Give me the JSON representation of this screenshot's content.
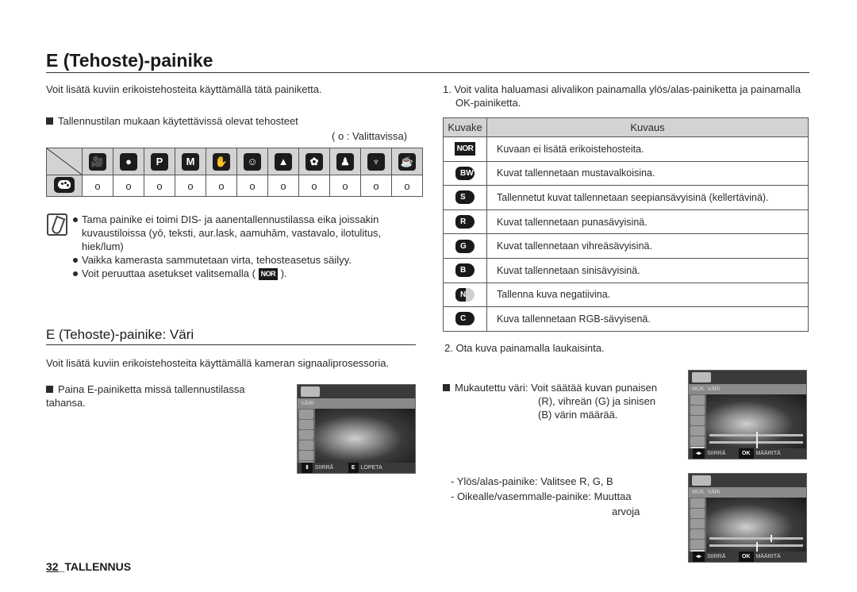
{
  "title": "E (Tehoste)-painike",
  "intro": "Voit lisätä kuviin erikoistehosteita käyttämällä tätä painiketta.",
  "modes_heading": "Tallennustilan mukaan käytettävissä olevat tehosteet",
  "modes_legend": "( o : Valittavissa)",
  "modes_table": {
    "row_icon": "palette-icon",
    "columns": [
      {
        "icon": "movie-icon",
        "glyph": "🎥"
      },
      {
        "icon": "auto-icon",
        "glyph": "●"
      },
      {
        "icon": "program-icon",
        "glyph": "P"
      },
      {
        "icon": "manual-icon",
        "glyph": "M"
      },
      {
        "icon": "dis-icon",
        "glyph": "✋"
      },
      {
        "icon": "photo-help-icon",
        "glyph": "☺"
      },
      {
        "icon": "landscape-icon",
        "glyph": "▲"
      },
      {
        "icon": "closeup-icon",
        "glyph": "✿"
      },
      {
        "icon": "portrait-icon",
        "glyph": "♟"
      },
      {
        "icon": "food-icon",
        "glyph": "♆"
      },
      {
        "icon": "cafe-icon",
        "glyph": "☕"
      }
    ],
    "values": [
      "o",
      "o",
      "o",
      "o",
      "o",
      "o",
      "o",
      "o",
      "o",
      "o",
      "o"
    ]
  },
  "note": {
    "items": [
      "Tama painike ei toimi DIS- ja aanentallennustilassa eika joissakin kuvaustiloissa (yō, teksti, aur.lask, aamuhām, vastavalo, ilotulitus, hiek/lum)",
      "Vaikka kamerasta sammutetaan virta, tehosteasetus säilyy."
    ],
    "last_item_prefix": "Voit peruuttaa asetukset valitsemalla (",
    "last_item_icon": "NOR",
    "last_item_suffix": ")."
  },
  "section2": {
    "title": "E (Tehoste)-painike: Väri",
    "intro": "Voit lisätä kuviin erikoistehosteita käyttämällä kameran signaaliprosessoria.",
    "instruction": "Paina E-painiketta missä tallennustilassa tahansa.",
    "lcd1": {
      "menu": "VÄRI",
      "left_key": "SIIRRÄ",
      "right_key_icon": "E",
      "right_key": "LOPETA"
    }
  },
  "step1": "1. Voit valita haluamasi alivalikon painamalla ylös/alas-painiketta ja painamalla OK-painiketta.",
  "effects_table": {
    "headers": [
      "Kuvake",
      "Kuvaus"
    ],
    "rows": [
      {
        "icon": "NOR",
        "type": "nor",
        "desc": "Kuvaan ei lisätä erikoistehosteita."
      },
      {
        "icon": "BW",
        "type": "blob",
        "desc": "Kuvat tallennetaan mustavalkoisina."
      },
      {
        "icon": "S",
        "type": "blob",
        "desc": "Tallennetut kuvat tallennetaan seepiansävyisinä (kellertävinä)."
      },
      {
        "icon": "R",
        "type": "blob",
        "desc": "Kuvat tallennetaan punasävyisinä."
      },
      {
        "icon": "G",
        "type": "blob",
        "desc": "Kuvat tallennetaan vihreäsävyisinä."
      },
      {
        "icon": "B",
        "type": "blob",
        "desc": "Kuvat tallennetaan sinisävyisinä."
      },
      {
        "icon": "N",
        "type": "neg",
        "desc": "Tallenna kuva negatiivina."
      },
      {
        "icon": "C",
        "type": "blob",
        "desc": "Kuva tallennetaan RGB-sävyisenä."
      }
    ]
  },
  "step2": "2. Ota kuva painamalla laukaisinta.",
  "custom": {
    "label": "Mukautettu väri:",
    "line1": "Voit säätää kuvan punaisen",
    "line2": "(R), vihreän (G) ja sinisen",
    "line3": "(B) värin määrää.",
    "lcd": {
      "menu": "MUK. VÄRI",
      "left_key": "SIIRRÄ",
      "right_key_icon": "OK",
      "right_key": "MÄÄRITÄ"
    },
    "hint1": "- Ylös/alas-painike: Valitsee R, G, B",
    "hint2": "- Oikealle/vasemmalle-painike: Muuttaa",
    "hint3": "arvoja",
    "sliders_a": [
      0.5,
      0.5,
      0.5
    ],
    "sliders_b": [
      0.65,
      0.5,
      0.5
    ]
  },
  "footer": {
    "page": "32",
    "section": "_TALLENNUS"
  }
}
